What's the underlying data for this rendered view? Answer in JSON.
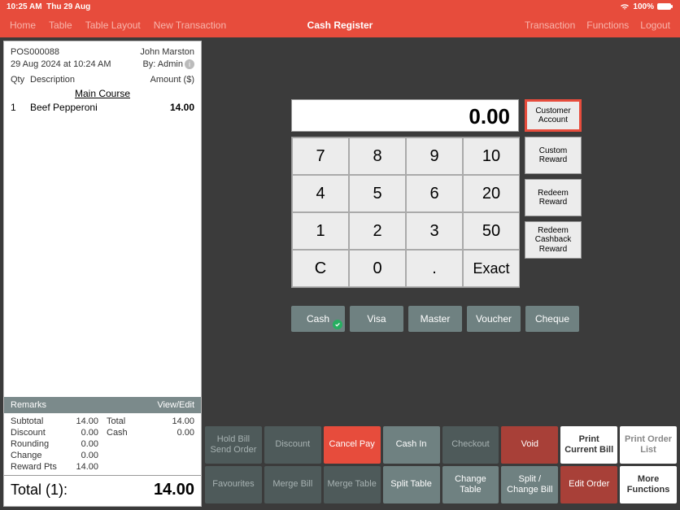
{
  "status": {
    "time": "10:25 AM",
    "date": "Thu 29 Aug",
    "battery": "100%"
  },
  "nav": {
    "left": [
      "Home",
      "Table",
      "Table Layout",
      "New Transaction"
    ],
    "title": "Cash Register",
    "right": [
      "Transaction",
      "Functions",
      "Logout"
    ]
  },
  "receipt": {
    "id": "POS000088",
    "customer": "John Marston",
    "timestamp": "29 Aug 2024 at 10:24 AM",
    "by": "By: Admin",
    "cols": {
      "qty": "Qty",
      "desc": "Description",
      "amt": "Amount ($)"
    },
    "course": "Main Course",
    "items": [
      {
        "qty": "1",
        "desc": "Beef Pepperoni",
        "amt": "14.00"
      }
    ],
    "remarks_label": "Remarks",
    "remarks_action": "View/Edit",
    "summary": {
      "subtotal_l": "Subtotal",
      "subtotal_v": "14.00",
      "total_l": "Total",
      "total_v": "14.00",
      "discount_l": "Discount",
      "discount_v": "0.00",
      "cash_l": "Cash",
      "cash_v": "0.00",
      "rounding_l": "Rounding",
      "rounding_v": "0.00",
      "change_l": "Change",
      "change_v": "0.00",
      "reward_l": "Reward Pts",
      "reward_v": "14.00"
    },
    "total_label": "Total (1):",
    "total_value": "14.00"
  },
  "keypad": {
    "display": "0.00",
    "keys": [
      "7",
      "8",
      "9",
      "10",
      "4",
      "5",
      "6",
      "20",
      "1",
      "2",
      "3",
      "50",
      "C",
      "0",
      ".",
      "Exact"
    ],
    "side": [
      "Customer Account",
      "Custom Reward",
      "Redeem Reward",
      "Redeem Cashback Reward"
    ]
  },
  "pay_methods": [
    "Cash",
    "Visa",
    "Master",
    "Voucher",
    "Cheque"
  ],
  "functions_row1": [
    "Hold Bill Send Order",
    "Discount",
    "Cancel Pay",
    "Cash In",
    "Checkout",
    "Void",
    "Print Current Bill",
    "Print Order List"
  ],
  "functions_row2": [
    "Favourites",
    "Merge Bill",
    "Merge Table",
    "Split Table",
    "Change Table",
    "Split / Change Bill",
    "Edit Order",
    "More Functions"
  ]
}
